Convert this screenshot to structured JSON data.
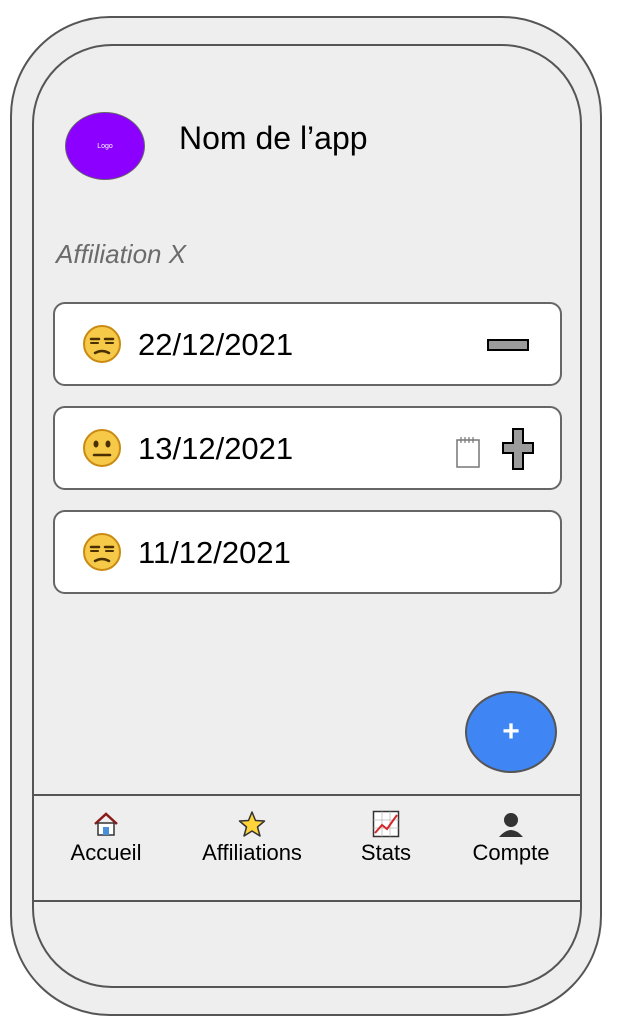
{
  "app": {
    "logo_text": "Logo",
    "title": "Nom de l’app"
  },
  "section": {
    "title": "Affiliation X"
  },
  "entries": [
    {
      "date": "22/12/2021",
      "mood_icon": "unamused-face-icon",
      "action": "minus"
    },
    {
      "date": "13/12/2021",
      "mood_icon": "neutral-face-icon",
      "action": "plus",
      "has_note": true
    },
    {
      "date": "11/12/2021",
      "mood_icon": "unamused-face-icon"
    }
  ],
  "fab": {
    "label": "+"
  },
  "nav": {
    "items": [
      {
        "label": "Accueil",
        "icon": "house-icon"
      },
      {
        "label": "Affiliations",
        "icon": "star-icon"
      },
      {
        "label": "Stats",
        "icon": "chart-icon"
      },
      {
        "label": "Compte",
        "icon": "user-icon"
      }
    ]
  },
  "colors": {
    "logo": "#8b00ff",
    "fab": "#3f85f4",
    "background": "#eeeeee"
  }
}
